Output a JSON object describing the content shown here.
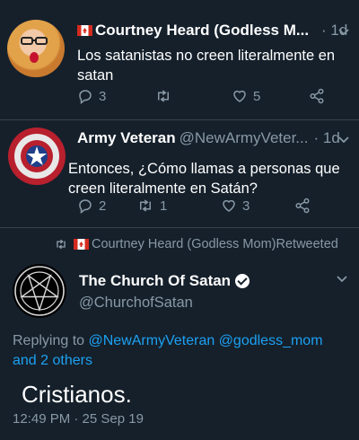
{
  "tweets": [
    {
      "display_name": "Courtney Heard (Godless M...",
      "time": "· 1d",
      "text": "Los satanistas no creen literalmente en satan",
      "replies": "3",
      "retweets": "",
      "likes": "5"
    },
    {
      "display_name": "Army Veteran",
      "handle": "@NewArmyVeter...",
      "time": "· 1d",
      "text": "Entonces, ¿Cómo llamas a personas que creen literalmente en Satán?",
      "replies": "2",
      "retweets": "1",
      "likes": "3"
    }
  ],
  "retweet_note": {
    "name": "Courtney Heard (Godless Mom)",
    "suffix": " Retweeted"
  },
  "main_tweet": {
    "display_name": "The Church Of Satan",
    "handle": "@ChurchofSatan",
    "replying_prefix": "Replying to ",
    "reply_handle_1": "@NewArmyVeteran",
    "reply_handle_2": "@godless_mom",
    "reply_others": "and 2 others",
    "text": "Cristianos.",
    "timestamp": "12:49 PM · 25 Sep 19"
  },
  "colors": {
    "background": "#15202b",
    "secondary_text": "#8899a6",
    "link": "#1da1f2",
    "divider": "#38444d"
  }
}
